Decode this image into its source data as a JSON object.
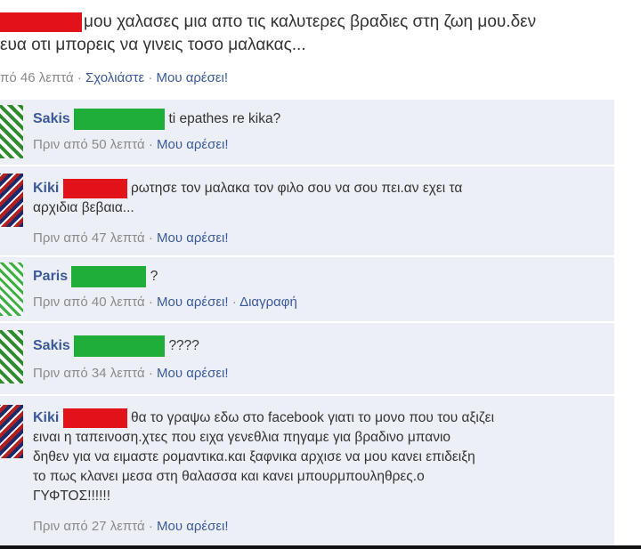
{
  "post": {
    "line1": "μου χαλασες μια απο τις καλυτερες βραδιες στη ζωη μου.δεν",
    "line2": "ευα οτι μπορεις να γινεις τοσο μαλακας...",
    "time": "πό 46 λεπτά",
    "comment_label": "Σχολιάστε",
    "like_label": "Μου αρέσει!"
  },
  "comments": [
    {
      "name": "Sakis",
      "text": "ti epathes re kika?",
      "time": "Πριν από 50 λεπτά",
      "like": "Μου αρέσει!"
    },
    {
      "name": "Kiki",
      "text1": "ρωτησε τον μαλακα τον φιλο σου να σου πει.αν εχει τα",
      "text2": "αρχιδια βεβαια...",
      "time": "Πριν από 47 λεπτά",
      "like": "Μου αρέσει!"
    },
    {
      "name": "Paris",
      "text": "?",
      "time": "Πριν από 40 λεπτά",
      "like": "Μου αρέσει!",
      "delete": "Διαγραφή"
    },
    {
      "name": "Sakis",
      "text": "????",
      "time": "Πριν από 34 λεπτά",
      "like": "Μου αρέσει!"
    },
    {
      "name": "Kiki",
      "text1": "θα το γραψω εδω στο facebook γιατι το μονο που του αξιζει",
      "text2": "ειναι η ταπεινοση.χτες που ειχα γενεθλια πηγαμε για βραδινο μπανιο",
      "text3": "δηθεν για να ειμαστε ρομαντικα.και ξαφνικα αρχισε να μου κανει επιδειξη",
      "text4": "το πως κλανει μεσα στη θαλασσα και κανει μπουρμπουληθρες.ο",
      "text5": "ΓΥΦΤΟΣ!!!!!!",
      "time": "Πριν από 27 λεπτά",
      "like": "Μου αρέσει!"
    }
  ],
  "colors": {
    "redaction_red": "#e2121b",
    "redaction_green": "#1fae3a",
    "link": "#3b5998",
    "comment_bg": "#eceff5"
  }
}
